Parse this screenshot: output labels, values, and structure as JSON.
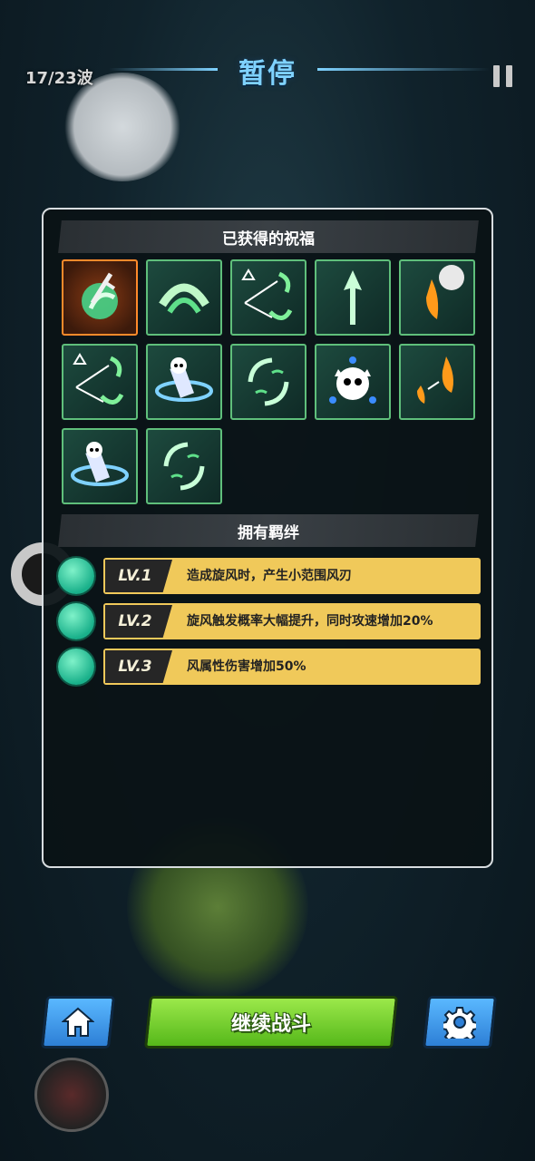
{
  "hud": {
    "wave": "17/23波",
    "title": "暂停"
  },
  "blessings": {
    "header": "已获得的祝福",
    "items": [
      {
        "name": "wind-sword-blessing-icon",
        "selected": true
      },
      {
        "name": "wind-slash-icon",
        "selected": false
      },
      {
        "name": "split-wind-arrow-icon",
        "selected": false
      },
      {
        "name": "wind-arrow-up-icon",
        "selected": false
      },
      {
        "name": "fire-drop-orb-icon",
        "selected": false
      },
      {
        "name": "split-wind-arrow-icon-2",
        "selected": false
      },
      {
        "name": "spirit-vortex-icon",
        "selected": false
      },
      {
        "name": "wind-cycle-icon",
        "selected": false
      },
      {
        "name": "frost-spirit-icon",
        "selected": false
      },
      {
        "name": "fire-drop-boost-icon",
        "selected": false
      },
      {
        "name": "spirit-vortex-icon-2",
        "selected": false
      },
      {
        "name": "wind-cycle-icon-2",
        "selected": false
      }
    ]
  },
  "bonds": {
    "header": "拥有羁绊",
    "rows": [
      {
        "level": "LV.1",
        "text": "造成旋风时，产生小范围风刃"
      },
      {
        "level": "LV.2",
        "text": "旋风触发概率大幅提升，同时攻速增加20%"
      },
      {
        "level": "LV.3",
        "text": "风属性伤害增加50%"
      }
    ]
  },
  "buttons": {
    "continue": "继续战斗"
  },
  "colors": {
    "accent_blue": "#7fd2ff",
    "tile_border": "#5fbf7b",
    "selected_border": "#ff8a2b",
    "bond_bar": "#f0c95a",
    "continue_green": "#6ccf2a"
  }
}
